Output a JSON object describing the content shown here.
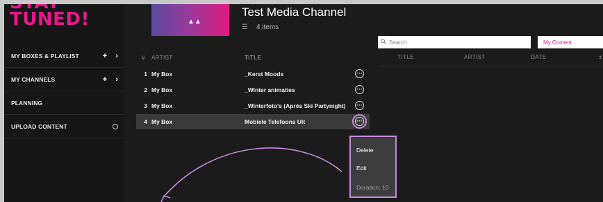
{
  "logo": {
    "line1": "STAY",
    "line2": "TUNED!"
  },
  "sidebar": {
    "items": [
      {
        "label": "MY BOXES & PLAYLIST",
        "plus": "+",
        "chevron": "›"
      },
      {
        "label": "MY CHANNELS",
        "plus": "+",
        "chevron": "›"
      },
      {
        "label": "PLANNING"
      },
      {
        "label": "UPLOAD CONTENT"
      }
    ]
  },
  "channel": {
    "title": "Test Media Channel",
    "item_count": "4 items",
    "cover_mark": "▲▲"
  },
  "playlist": {
    "headers": {
      "num": "#",
      "artist": "ARTIST",
      "title": "TITLE"
    },
    "rows": [
      {
        "num": "1",
        "artist": "My Box",
        "title": "_Kerst Moods"
      },
      {
        "num": "2",
        "artist": "My Box",
        "title": "_Winter animaties"
      },
      {
        "num": "3",
        "artist": "My Box",
        "title": "_Winterfoto's (Aprés Ski Partynight)"
      },
      {
        "num": "4",
        "artist": "My Box",
        "title": "Mobiele Telefoons Uit"
      }
    ],
    "more_glyph": "···"
  },
  "context_menu": {
    "items": [
      "Delete",
      "Edit",
      "Duration: 10"
    ]
  },
  "right_panel": {
    "search_placeholder": "Search",
    "filter_value": "My Content",
    "headers": [
      "TITLE",
      "ARTIST",
      "DATE"
    ],
    "upload_glyph": "±"
  },
  "colors": {
    "accent": "#e6198a",
    "highlight": "#c58be0",
    "background": "#1b1b1b"
  }
}
